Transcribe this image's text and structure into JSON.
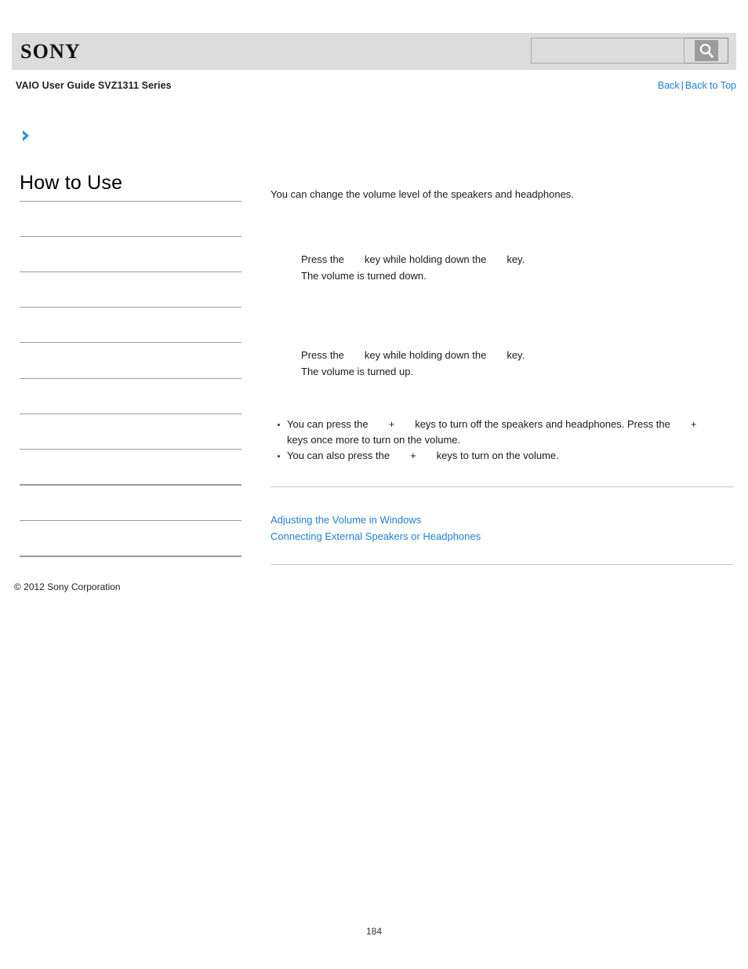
{
  "header": {
    "logo_text": "SONY",
    "search": {
      "value": "",
      "placeholder": "",
      "button_icon": "search-icon"
    }
  },
  "subheader": {
    "guide_title": "VAIO User Guide SVZ1311 Series",
    "back_label": "Back",
    "separator": "|",
    "back_to_top_label": "Back to Top"
  },
  "sidebar": {
    "heading": "How to Use",
    "items": [
      {
        "label": ""
      },
      {
        "label": ""
      },
      {
        "label": ""
      },
      {
        "label": ""
      },
      {
        "label": ""
      },
      {
        "label": ""
      },
      {
        "label": ""
      },
      {
        "label": ""
      },
      {
        "label": ""
      },
      {
        "label": ""
      },
      {
        "label": ""
      }
    ],
    "copyright": "© 2012 Sony Corporation"
  },
  "content": {
    "intro": "You can change the volume level of the speakers and headphones.",
    "steps": [
      {
        "line1_a": "Press the",
        "line1_b": "key while holding down the",
        "line1_c": "key.",
        "line2": "The volume is turned down."
      },
      {
        "line1_a": "Press the",
        "line1_b": "key while holding down the",
        "line1_c": "key.",
        "line2": "The volume is turned up."
      }
    ],
    "notes": [
      {
        "a": "You can press the",
        "plus": "+",
        "b": "keys to turn off the speakers and headphones. Press the",
        "plus2": "+",
        "c": "keys once more to turn on the volume."
      },
      {
        "a": "You can also press the",
        "plus": "+",
        "b": "keys to turn on the volume."
      }
    ],
    "related": [
      {
        "label": "Adjusting the Volume in Windows"
      },
      {
        "label": "Connecting External Speakers or Headphones"
      }
    ]
  },
  "footer": {
    "page_number": "184"
  },
  "colors": {
    "link": "#1f7fd4",
    "header_bar": "#dcdcdc",
    "rule": "#9b9b9b",
    "content_rule": "#c7c7c7"
  }
}
